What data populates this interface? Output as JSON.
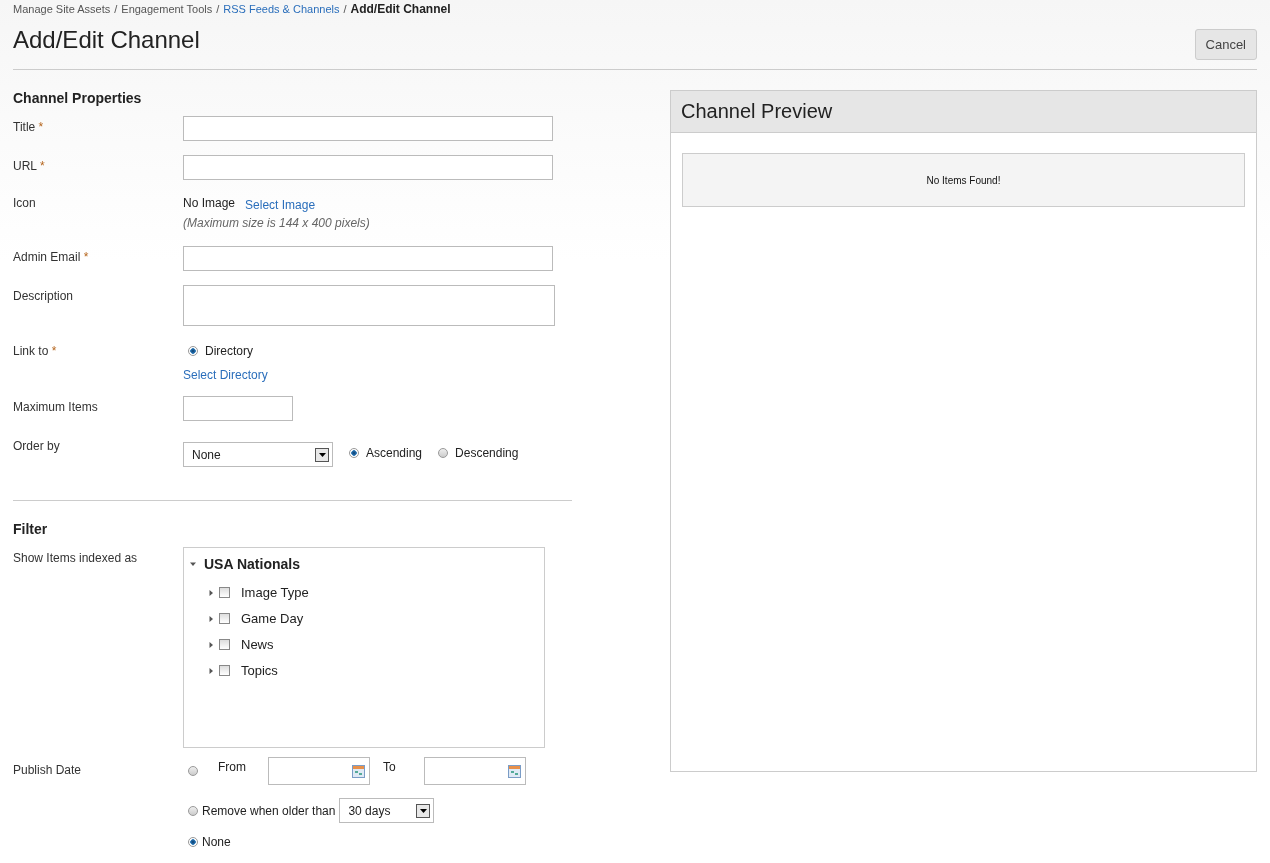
{
  "breadcrumb": [
    {
      "label": "Manage Site Assets",
      "kind": "plain"
    },
    {
      "label": "Engagement Tools",
      "kind": "plain"
    },
    {
      "label": "RSS Feeds & Channels",
      "kind": "link"
    },
    {
      "label": "Add/Edit Channel",
      "kind": "current"
    }
  ],
  "breadcrumb_separator": "/",
  "title": "Add/Edit Channel",
  "cancel_button": "Cancel",
  "channel_properties": {
    "heading": "Channel Properties",
    "fields": [
      {
        "kind": "text",
        "label": "Title",
        "required_mark": "*"
      },
      {
        "kind": "text",
        "label": "URL",
        "required_mark": "*"
      },
      {
        "kind": "image",
        "label": "Icon",
        "value": "No Image",
        "link": "Select Image",
        "note": "(Maximum size is 144 x 400 pixels)"
      },
      {
        "kind": "text",
        "label": "Admin Email",
        "required_mark": "*"
      },
      {
        "kind": "textarea",
        "label": "Description"
      },
      {
        "kind": "link_to",
        "label": "Link to",
        "required_mark": "*",
        "options": [
          {
            "label": "Directory",
            "selected": true
          }
        ],
        "link": "Select Directory"
      },
      {
        "kind": "short",
        "label": "Maximum Items"
      },
      {
        "kind": "order",
        "label": "Order by",
        "select": "None",
        "options": [
          {
            "label": "Ascending",
            "selected": true
          },
          {
            "label": "Descending",
            "selected": false
          }
        ]
      }
    ]
  },
  "filter": {
    "heading": "Filter",
    "tree_label": "Show Items indexed as",
    "tree": {
      "label": "USA Nationals",
      "expanded": true,
      "children": [
        {
          "label": "Image Type",
          "expanded": false,
          "checked": false
        },
        {
          "label": "Game Day",
          "expanded": false,
          "checked": false
        },
        {
          "label": "News",
          "expanded": false,
          "checked": false
        },
        {
          "label": "Topics",
          "expanded": false,
          "checked": false
        }
      ]
    },
    "publish_label": "Publish Date",
    "publish_options": [
      {
        "kind": "range",
        "label": "From",
        "selected": false,
        "to_label": "To"
      },
      {
        "kind": "older",
        "label": "Remove when older than",
        "selected": false,
        "select": "30 days"
      },
      {
        "kind": "none",
        "label": "None",
        "selected": true
      }
    ]
  },
  "preview": {
    "title": "Channel Preview",
    "empty_message": "No Items Found!"
  }
}
